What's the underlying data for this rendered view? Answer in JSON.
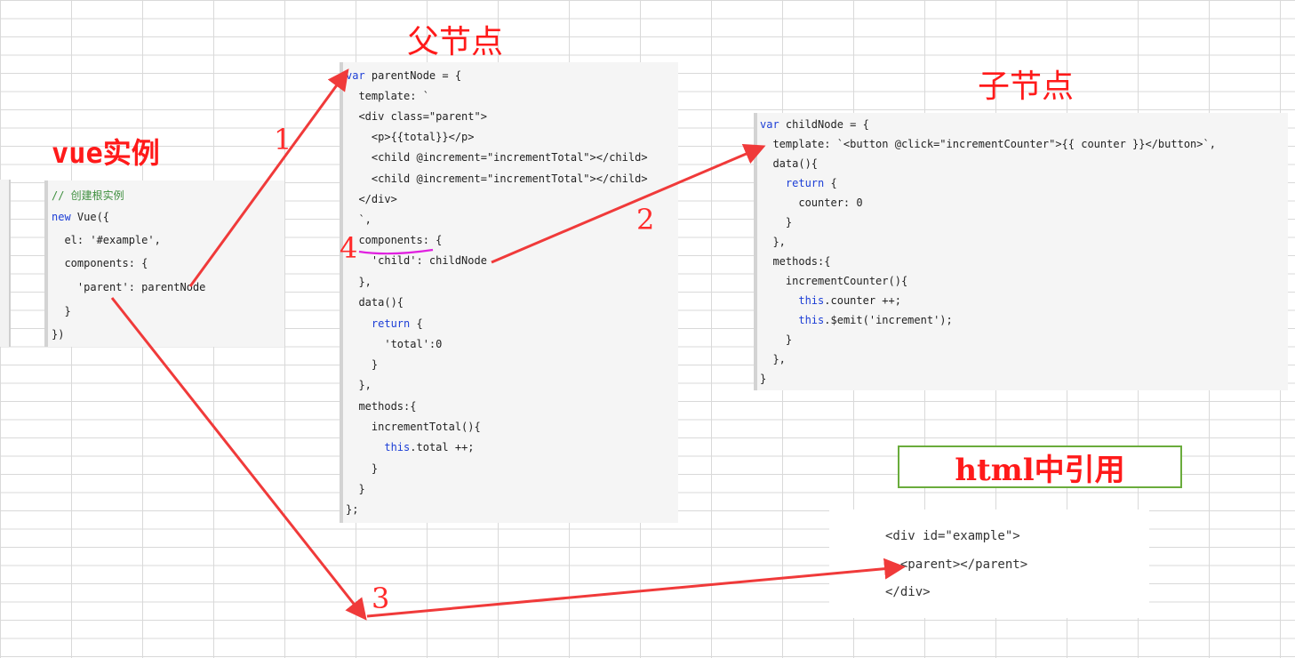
{
  "titles": {
    "vue_instance": "vue实例",
    "parent_node": "父节点",
    "child_node": "子节点",
    "html_usage": "html中引用"
  },
  "step_labels": [
    "1",
    "2",
    "3",
    "4"
  ],
  "code": {
    "vue_instance": [
      "// 创建根实例",
      "new Vue({",
      "  el: '#example',",
      "  components: {",
      "    'parent': parentNode",
      "  }",
      "})"
    ],
    "parent_node": [
      "var parentNode = {",
      "  template: `",
      "  <div class=\"parent\">",
      "    <p>{{total}}</p>",
      "    <child @increment=\"incrementTotal\"></child>",
      "    <child @increment=\"incrementTotal\"></child>",
      "  </div>",
      "  `,",
      "  components: {",
      "    'child': childNode",
      "  },",
      "  data(){",
      "    return {",
      "      'total':0",
      "    }",
      "  },",
      "  methods:{",
      "    incrementTotal(){",
      "      this.total ++;",
      "    }",
      "  }",
      "};"
    ],
    "child_node": [
      "var childNode = {",
      "  template: `<button @click=\"incrementCounter\">{{ counter }}</button>`,",
      "  data(){",
      "    return {",
      "      counter: 0",
      "    }",
      "  },",
      "  methods:{",
      "    incrementCounter(){",
      "      this.counter ++;",
      "      this.$emit('increment');",
      "    }",
      "  },",
      "}"
    ],
    "html_usage": [
      "<div id=\"example\">",
      "  <parent></parent>",
      "</div>"
    ]
  },
  "colors": {
    "arrow": "#f03a3a",
    "title": "#ff1a1a",
    "keyword": "#1c3ed6",
    "comment": "#3f8f3f",
    "underline": "#e020e0",
    "box_border": "#6aac3c"
  }
}
